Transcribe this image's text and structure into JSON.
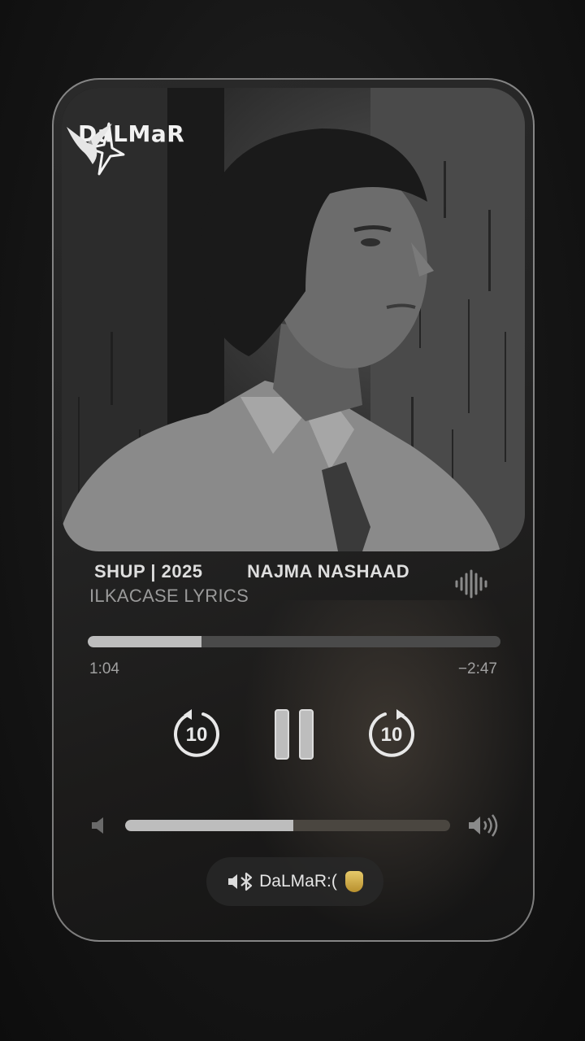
{
  "player": {
    "brand": "DaLMaR",
    "title": "SHUP | 2025",
    "artist": "NAJMA NASHAAD",
    "subtitle": "ILKACASE LYRICS",
    "progress_fraction": 0.275,
    "time_elapsed": "1:04",
    "time_remaining": "−2:47",
    "skip_back_label": "10",
    "skip_forward_label": "10",
    "volume_fraction": 0.517,
    "device_label": "DaLMaR:(",
    "icons": {
      "wave": "waveform-icon",
      "skip_back": "skip-back-10-icon",
      "pause": "pause-icon",
      "skip_forward": "skip-forward-10-icon",
      "volume_low": "speaker-low-icon",
      "volume_high": "speaker-high-icon",
      "bluetooth": "bluetooth-speaker-icon",
      "logo_star": "star-icon",
      "logo_eagle": "eagle-icon"
    }
  }
}
